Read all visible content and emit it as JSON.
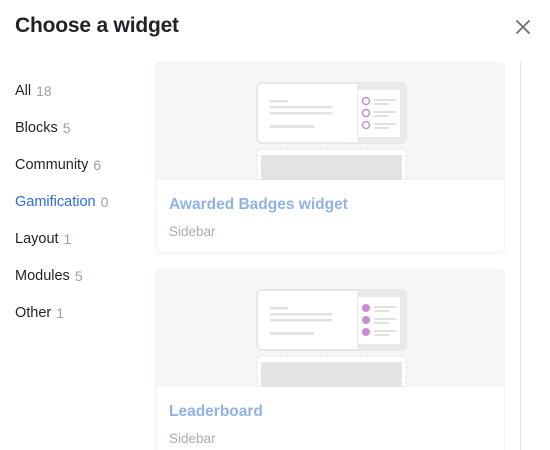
{
  "dialog": {
    "title": "Choose a widget",
    "close_icon": "close-icon"
  },
  "categories": [
    {
      "label": "All",
      "count": "18"
    },
    {
      "label": "Blocks",
      "count": "5"
    },
    {
      "label": "Community",
      "count": "6"
    },
    {
      "label": "Gamification",
      "count": "0",
      "active": true
    },
    {
      "label": "Layout",
      "count": "1"
    },
    {
      "label": "Modules",
      "count": "5"
    },
    {
      "label": "Other",
      "count": "1"
    }
  ],
  "widgets": [
    {
      "name": "Awarded Badges widget",
      "placement": "Sidebar",
      "thumbnail_icon": "sidebar-list-thumbnail",
      "marker_color": "#c98bd6"
    },
    {
      "name": "Leaderboard",
      "placement": "Sidebar",
      "thumbnail_icon": "sidebar-list-thumbnail",
      "marker_color": "#c98bd6"
    }
  ],
  "colors": {
    "accent": "#2a6ed8",
    "muted_link": "#8fb3e4",
    "preview_bg": "#f5f6f7"
  }
}
